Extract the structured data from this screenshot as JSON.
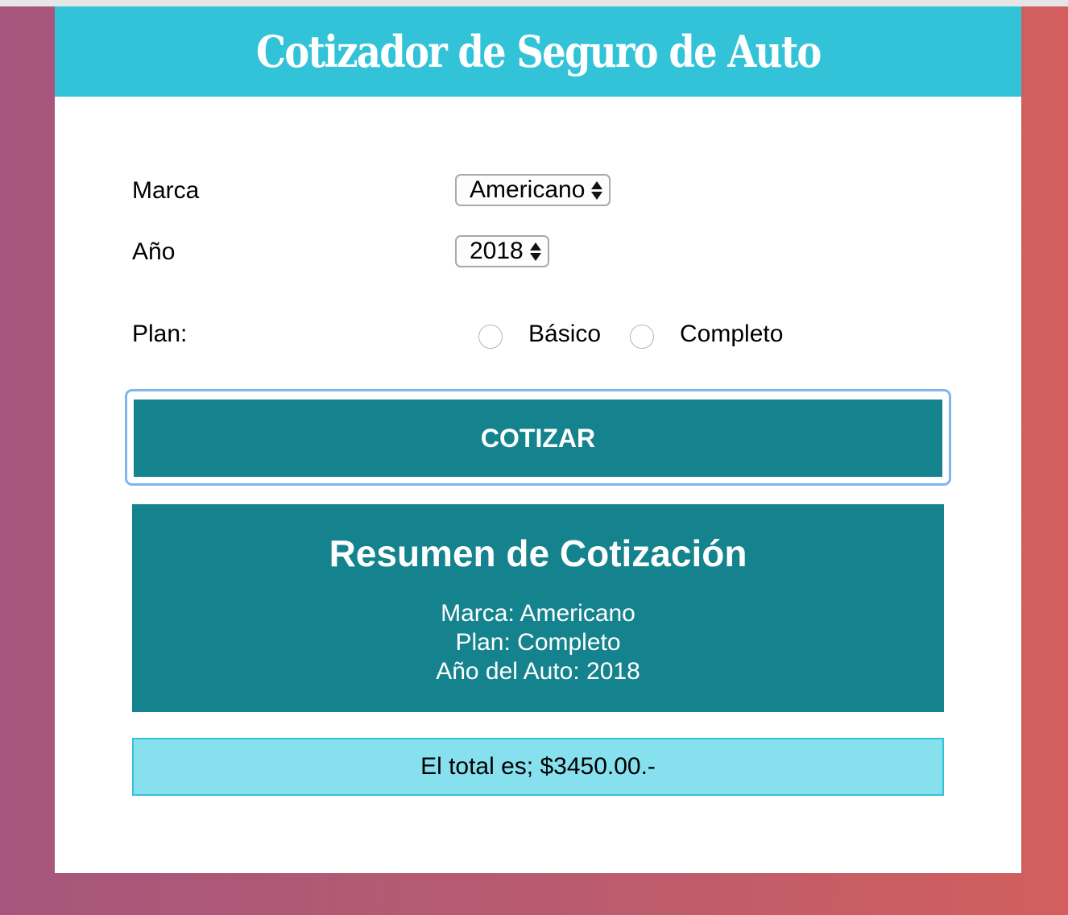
{
  "header": {
    "title": "Cotizador de Seguro de Auto"
  },
  "form": {
    "marca_label": "Marca",
    "marca_value": "Americano",
    "anio_label": "Año",
    "anio_value": "2018",
    "plan_label": "Plan:",
    "plan_options": [
      {
        "label": "Básico",
        "selected": false
      },
      {
        "label": "Completo",
        "selected": false
      }
    ],
    "submit_label": "COTIZAR"
  },
  "summary": {
    "title": "Resumen de Cotización",
    "marca_line": "Marca: Americano",
    "plan_line": "Plan: Completo",
    "anio_line": "Año del Auto: 2018"
  },
  "total": {
    "text": "El total es; $3450.00.-"
  },
  "colors": {
    "header_bg": "#33c3d8",
    "button_bg": "#14838e",
    "total_bg": "#86e0ee",
    "gradient_left": "#a6567c",
    "gradient_right": "#d25f5d"
  }
}
